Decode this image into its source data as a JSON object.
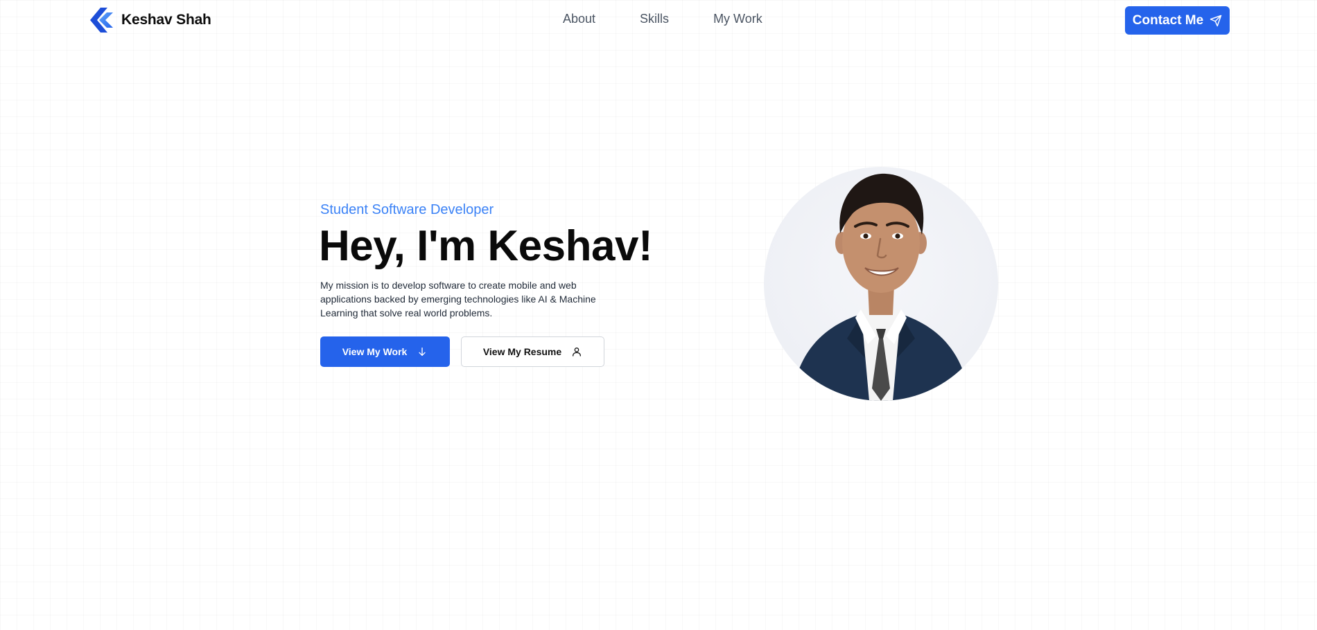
{
  "nav": {
    "brand": {
      "name": "Keshav Shah",
      "logo_icon": "chevron-left-logo-icon"
    },
    "links": [
      {
        "label": "About"
      },
      {
        "label": "Skills"
      },
      {
        "label": "My Work"
      }
    ],
    "contact_label": "Contact Me",
    "contact_icon": "paper-plane-icon"
  },
  "hero": {
    "eyebrow": "Student Software Developer",
    "title": "Hey, I'm Keshav!",
    "description": "My mission is to develop software to create mobile and web applications backed by emerging technologies like AI & Machine Learning that solve real world problems.",
    "primary_button": {
      "label": "View My Work",
      "icon": "arrow-down-icon"
    },
    "secondary_button": {
      "label": "View My Resume",
      "icon": "user-icon"
    },
    "portrait_icon": "profile-photo"
  },
  "colors": {
    "accent": "#2563eb",
    "eyebrow": "#3b82f6",
    "nav_text": "#4b5563",
    "text": "#0b0b0b"
  }
}
